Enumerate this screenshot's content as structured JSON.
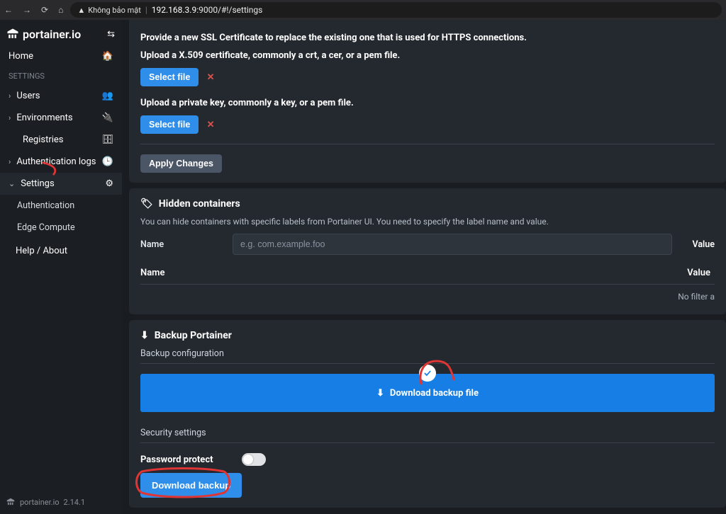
{
  "browser": {
    "security_text": "Không bảo mật",
    "url_prefix": "192.168.3.9",
    "url_suffix": ":9000/#!/settings"
  },
  "sidebar": {
    "logo_text": "portainer.io",
    "home": "Home",
    "section_settings": "SETTINGS",
    "items": {
      "users": "Users",
      "environments": "Environments",
      "registries": "Registries",
      "auth_logs": "Authentication logs",
      "settings": "Settings",
      "sub_auth": "Authentication",
      "sub_edge": "Edge Compute",
      "help": "Help / About"
    },
    "footer": {
      "brand": "portainer.io",
      "version": "2.14.1"
    }
  },
  "ssl": {
    "line1": "Provide a new SSL Certificate to replace the existing one that is used for HTTPS connections.",
    "line2": "Upload a X.509 certificate, commonly a crt, a cer, or a pem file.",
    "select_file": "Select file",
    "line3": "Upload a private key, commonly a key, or a pem file.",
    "apply": "Apply Changes"
  },
  "hidden": {
    "title": "Hidden containers",
    "desc": "You can hide containers with specific labels from Portainer UI. You need to specify the label name and value.",
    "name_label": "Name",
    "name_placeholder": "e.g. com.example.foo",
    "value_label": "Value",
    "col_name": "Name",
    "col_value": "Value",
    "no_filter": "No filter a"
  },
  "backup": {
    "title": "Backup Portainer",
    "config": "Backup configuration",
    "download_bar": "Download backup file",
    "security": "Security settings",
    "password_protect": "Password protect",
    "download_btn": "Download backup"
  }
}
